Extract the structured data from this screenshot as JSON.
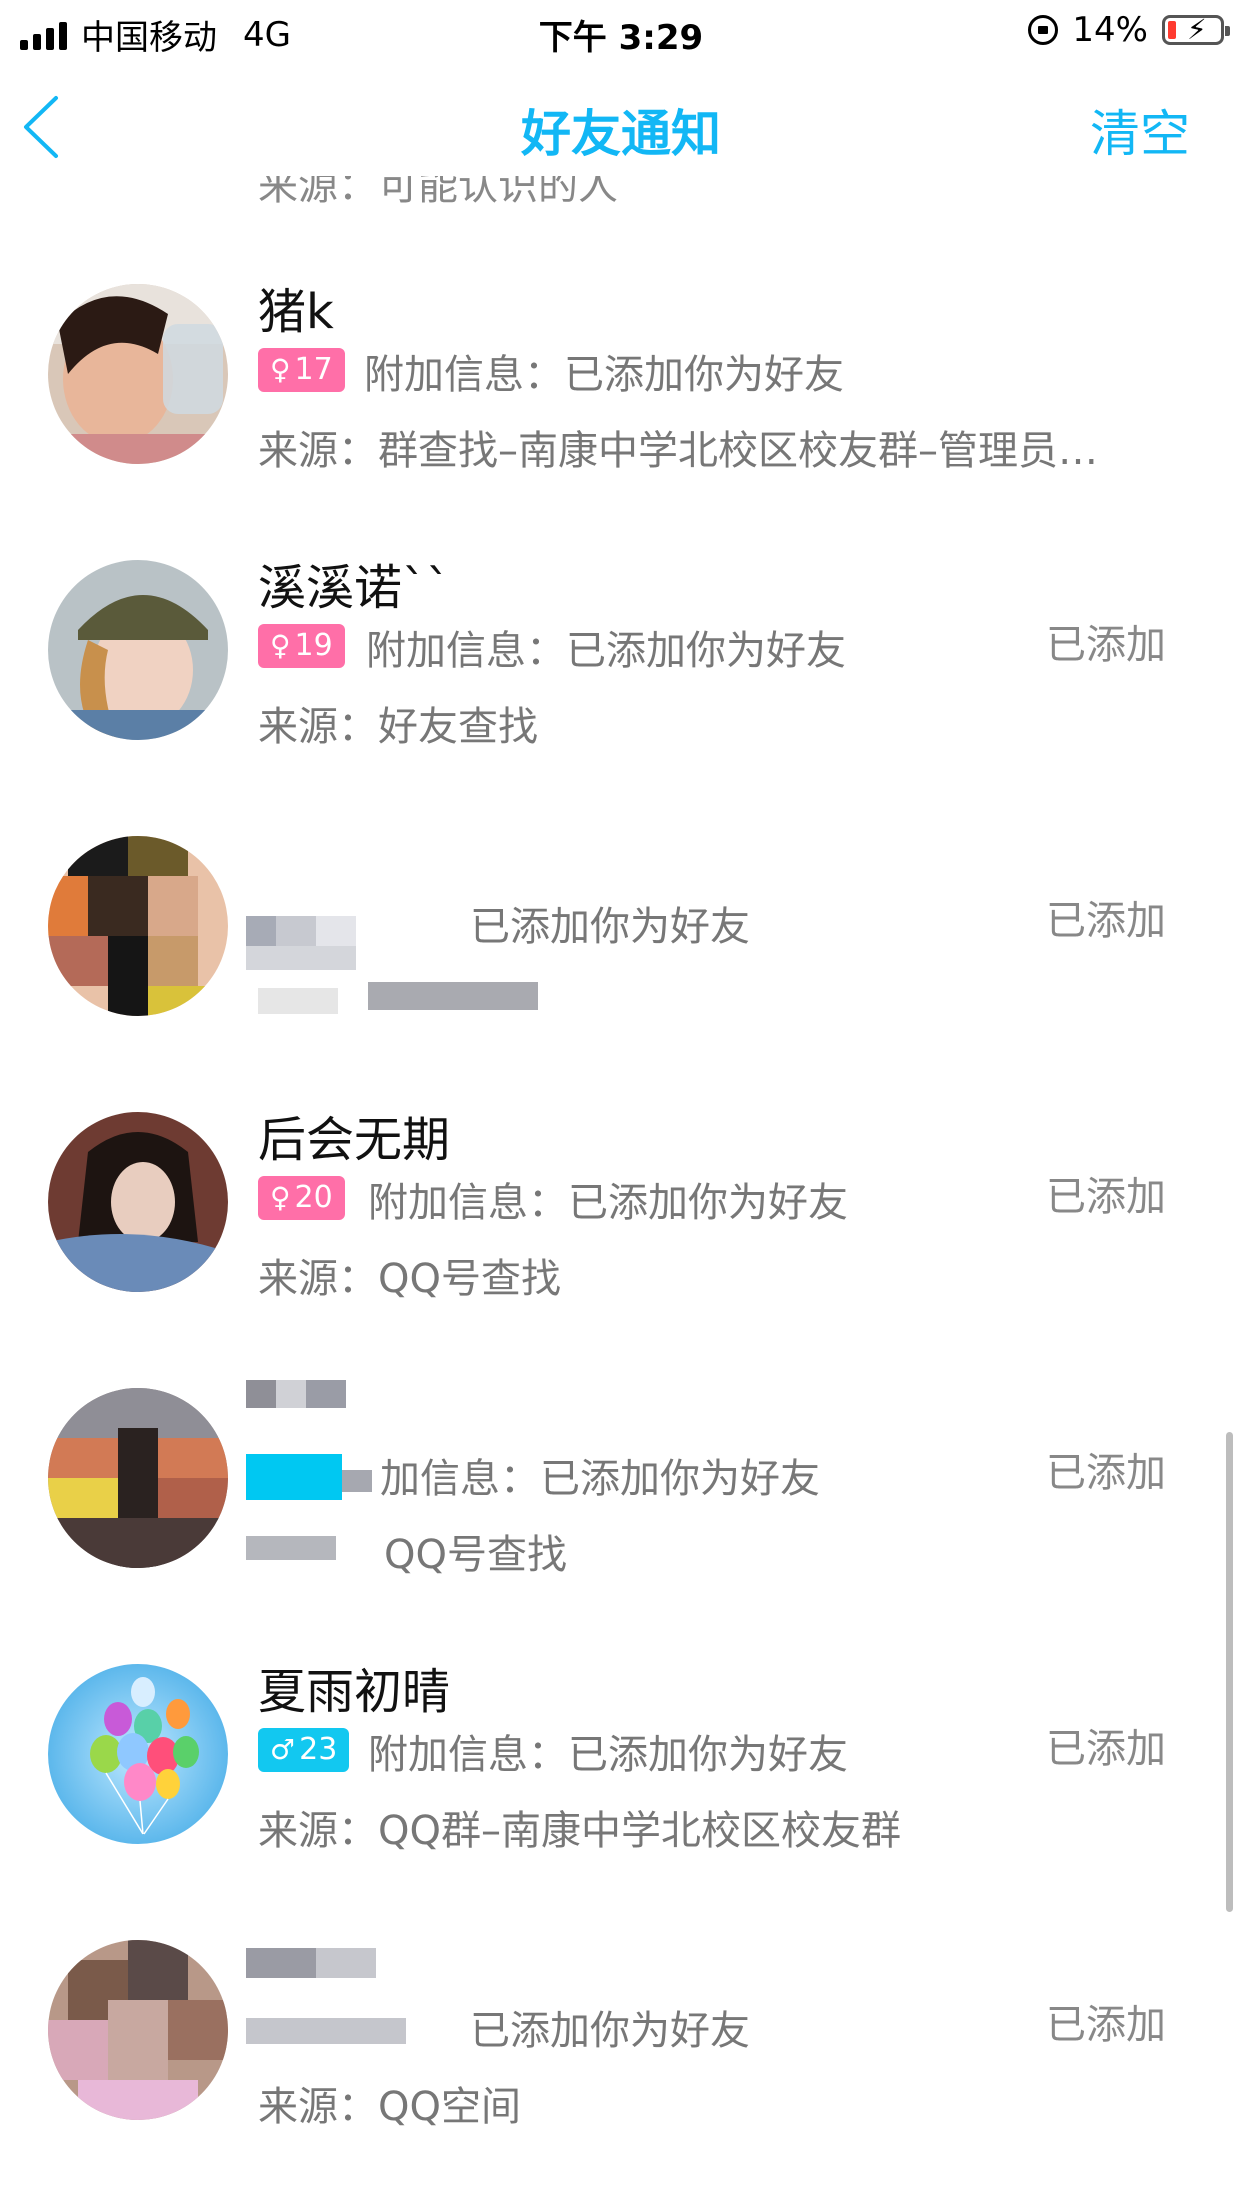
{
  "status_bar": {
    "carrier": "中国移动",
    "network": "4G",
    "time": "下午 3:29",
    "battery": "14%"
  },
  "nav": {
    "title": "好友通知",
    "clear_label": "清空",
    "back_icon": "chevron-left-icon"
  },
  "list": {
    "cutoff_text": "来源：可能认识的人",
    "items": [
      {
        "name": "猪k",
        "gender": "female",
        "age": "17",
        "extra_label": "附加信息：",
        "extra_value": "已添加你为好友",
        "source_label": "来源：",
        "source_value": "群查找–南康中学北校区校友群–管理员…",
        "status": ""
      },
      {
        "name": "溪溪诺``",
        "gender": "female",
        "age": "19",
        "extra_label": "附加信息：",
        "extra_value": "已添加你为好友",
        "source_label": "来源：",
        "source_value": "好友查找",
        "status": "已添加"
      },
      {
        "name": "",
        "gender": "",
        "age": "",
        "extra_label": "",
        "extra_value": "已添加你为好友",
        "source_label": "",
        "source_value": "",
        "status": "已添加"
      },
      {
        "name": "后会无期",
        "gender": "female",
        "age": "20",
        "extra_label": "附加信息：",
        "extra_value": "已添加你为好友",
        "source_label": "来源：",
        "source_value": "QQ号查找",
        "status": "已添加"
      },
      {
        "name": "",
        "gender": "",
        "age": "",
        "extra_label": "加信息：",
        "extra_value": "已添加你为好友",
        "source_label": "",
        "source_value": "QQ号查找",
        "status": "已添加"
      },
      {
        "name": "夏雨初晴",
        "gender": "male",
        "age": "23",
        "extra_label": "附加信息：",
        "extra_value": "已添加你为好友",
        "source_label": "来源：",
        "source_value": "QQ群–南康中学北校区校友群",
        "status": "已添加"
      },
      {
        "name": "",
        "gender": "",
        "age": "",
        "extra_label": "",
        "extra_value": "已添加你为好友",
        "source_label": "来源：",
        "source_value": "QQ空间",
        "status": "已添加"
      }
    ]
  },
  "colors": {
    "accent": "#12b7f5",
    "female_badge": "#ff6fa8",
    "male_badge": "#12c8f0",
    "secondary_text": "#777777"
  }
}
